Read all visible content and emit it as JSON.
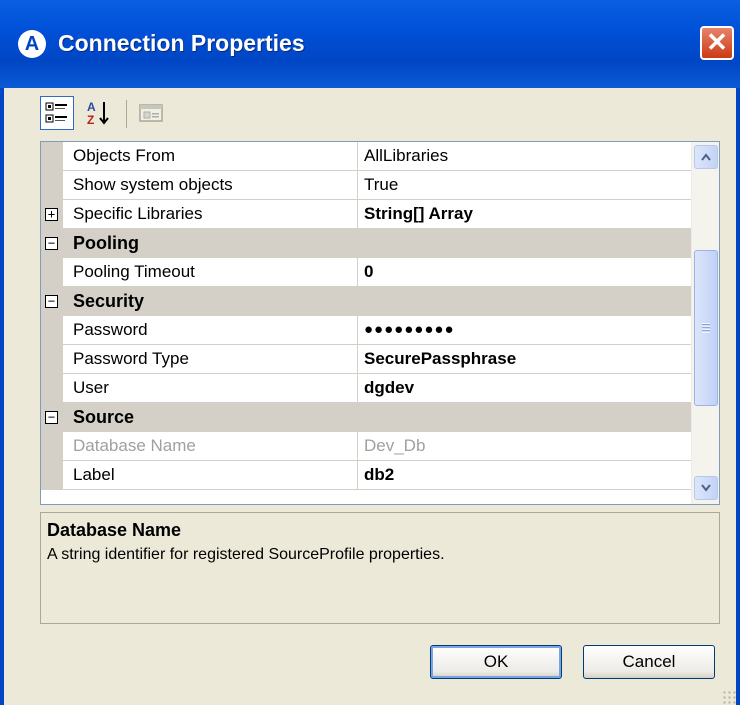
{
  "window": {
    "title": "Connection Properties",
    "close_glyph": "✕",
    "app_icon_glyph": "A"
  },
  "toolbar": {
    "categorized_icon": "categorized-view-icon",
    "alphabetical_icon": "alphabetical-sort-icon",
    "property_pages_icon": "property-pages-icon"
  },
  "grid": {
    "rows": [
      {
        "kind": "prop",
        "name": "Objects From",
        "value": "AllLibraries",
        "bold": false
      },
      {
        "kind": "prop",
        "name": "Show system objects",
        "value": "True",
        "bold": false
      },
      {
        "kind": "prop",
        "name": "Specific Libraries",
        "value": "String[] Array",
        "bold": true,
        "expandable": true
      },
      {
        "kind": "category",
        "name": "Pooling"
      },
      {
        "kind": "prop",
        "name": "Pooling Timeout",
        "value": "0",
        "bold": true
      },
      {
        "kind": "category",
        "name": "Security"
      },
      {
        "kind": "prop",
        "name": "Password",
        "value": "●●●●●●●●●",
        "bold": true
      },
      {
        "kind": "prop",
        "name": "Password Type",
        "value": "SecurePassphrase",
        "bold": true
      },
      {
        "kind": "prop",
        "name": "User",
        "value": "dgdev",
        "bold": true
      },
      {
        "kind": "category",
        "name": "Source"
      },
      {
        "kind": "prop",
        "name": "Database Name",
        "value": "Dev_Db",
        "bold": false,
        "disabled": true
      },
      {
        "kind": "prop",
        "name": "Label",
        "value": "db2",
        "bold": true
      }
    ],
    "expand_glyph": "+",
    "collapse_glyph": "−"
  },
  "description": {
    "title": "Database Name",
    "text": "A string identifier for registered SourceProfile properties."
  },
  "buttons": {
    "ok_label": "OK",
    "cancel_label": "Cancel"
  },
  "colors": {
    "titlebar": "#0046c4",
    "dialog_bg": "#ece9d8",
    "category_bg": "#d4d0c8"
  }
}
